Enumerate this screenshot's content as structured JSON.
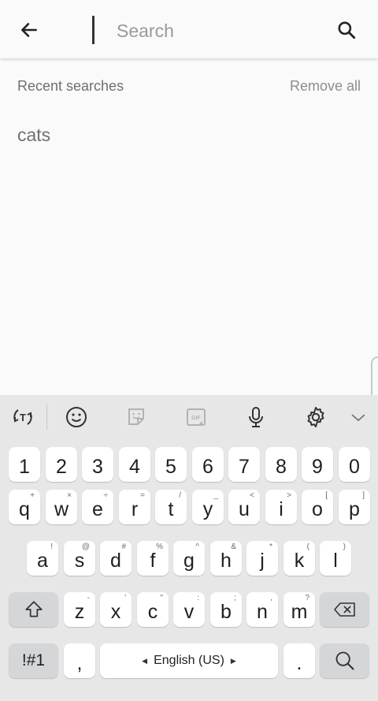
{
  "search": {
    "placeholder": "Search"
  },
  "recent": {
    "title": "Recent searches",
    "remove_all": "Remove all",
    "items": [
      "cats"
    ]
  },
  "keyboard": {
    "language": "English (US)",
    "toolbar_icons": [
      "translate-icon",
      "emoji-icon",
      "sticker-icon",
      "gif-icon",
      "microphone-icon",
      "settings-icon",
      "collapse-chevron-icon"
    ],
    "number_row": [
      "1",
      "2",
      "3",
      "4",
      "5",
      "6",
      "7",
      "8",
      "9",
      "0"
    ],
    "row1": [
      {
        "key": "q",
        "sub": "+"
      },
      {
        "key": "w",
        "sub": "×"
      },
      {
        "key": "e",
        "sub": "÷"
      },
      {
        "key": "r",
        "sub": "="
      },
      {
        "key": "t",
        "sub": "/"
      },
      {
        "key": "y",
        "sub": "_"
      },
      {
        "key": "u",
        "sub": "<"
      },
      {
        "key": "i",
        "sub": ">"
      },
      {
        "key": "o",
        "sub": "["
      },
      {
        "key": "p",
        "sub": "]"
      }
    ],
    "row2": [
      {
        "key": "a",
        "sub": "!"
      },
      {
        "key": "s",
        "sub": "@"
      },
      {
        "key": "d",
        "sub": "#"
      },
      {
        "key": "f",
        "sub": "%"
      },
      {
        "key": "g",
        "sub": "^"
      },
      {
        "key": "h",
        "sub": "&"
      },
      {
        "key": "j",
        "sub": "*"
      },
      {
        "key": "k",
        "sub": "("
      },
      {
        "key": "l",
        "sub": ")"
      }
    ],
    "row3": [
      {
        "key": "z",
        "sub": "-"
      },
      {
        "key": "x",
        "sub": "'"
      },
      {
        "key": "c",
        "sub": "\""
      },
      {
        "key": "v",
        "sub": ":"
      },
      {
        "key": "b",
        "sub": ";"
      },
      {
        "key": "n",
        "sub": ","
      },
      {
        "key": "m",
        "sub": "?"
      }
    ],
    "symbols_label": "!#1",
    "comma": ",",
    "period": "."
  }
}
